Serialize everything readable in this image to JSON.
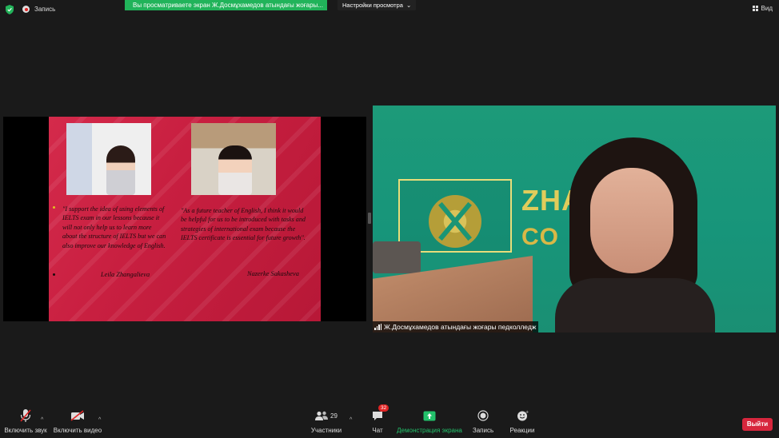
{
  "top_bar": {
    "record_label": "Запись",
    "share_banner": "Вы просматриваете экран Ж.Досмұхамедов атындағы жоғары...",
    "view_settings_label": "Настройки просмотра",
    "view_label": "Вид"
  },
  "slide": {
    "quote1": "\"I support the idea of using elements of IELTS exam in our lessons because it will not only help us to learn more about the structure of IELTS but we can also improve our knowledge of English.",
    "author1": "Leila Zhangalieva",
    "quote2": "\"As a future teacher of English, I think it would be helpful for us to be introduced with tasks and strategies of international exam because the IELTS certificate is essential for future growth\".",
    "author2": "Nazerke Sakasheva"
  },
  "video": {
    "participant_name": "Ж.Досмұхамедов атындағы жоғары педколледж",
    "sign_line1": "ZHAI SHA",
    "sign_line2": "CO"
  },
  "toolbar": {
    "mute_label": "Включить звук",
    "video_label": "Включить видео",
    "participants_label": "Участники",
    "participants_count": "29",
    "chat_label": "Чат",
    "chat_badge": "32",
    "share_label": "Демонстрация экрана",
    "record_label": "Запись",
    "reactions_label": "Реакции",
    "leave_label": "Выйти"
  },
  "colors": {
    "share_green": "#21b35a",
    "leave_red": "#d7263d",
    "slide_red": "#c81f40",
    "video_green": "#1a9577"
  }
}
